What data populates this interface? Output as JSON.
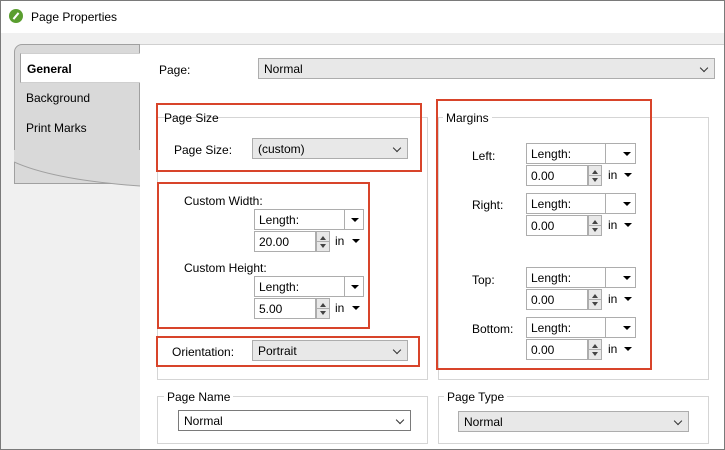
{
  "window": {
    "title": "Page Properties"
  },
  "tabs": [
    "General",
    "Background",
    "Print Marks"
  ],
  "page": {
    "label": "Page:",
    "value": "Normal"
  },
  "page_size": {
    "group_title": "Page Size",
    "label": "Page Size:",
    "value": "(custom)"
  },
  "custom": {
    "width_label": "Custom Width:",
    "width_type": "Length:",
    "width_value": "20.00",
    "width_unit": "in",
    "height_label": "Custom Height:",
    "height_type": "Length:",
    "height_value": "5.00",
    "height_unit": "in"
  },
  "orientation": {
    "label": "Orientation:",
    "value": "Portrait"
  },
  "margins": {
    "group_title": "Margins",
    "left_label": "Left:",
    "left_type": "Length:",
    "left_value": "0.00",
    "left_unit": "in",
    "right_label": "Right:",
    "right_type": "Length:",
    "right_value": "0.00",
    "right_unit": "in",
    "top_label": "Top:",
    "top_type": "Length:",
    "top_value": "0.00",
    "top_unit": "in",
    "bottom_label": "Bottom:",
    "bottom_type": "Length:",
    "bottom_value": "0.00",
    "bottom_unit": "in"
  },
  "page_name": {
    "group_title": "Page Name",
    "value": "Normal"
  },
  "page_type": {
    "group_title": "Page Type",
    "value": "Normal"
  },
  "colors": {
    "highlight": "#d8442a",
    "app_icon": "#5a9e2f"
  }
}
